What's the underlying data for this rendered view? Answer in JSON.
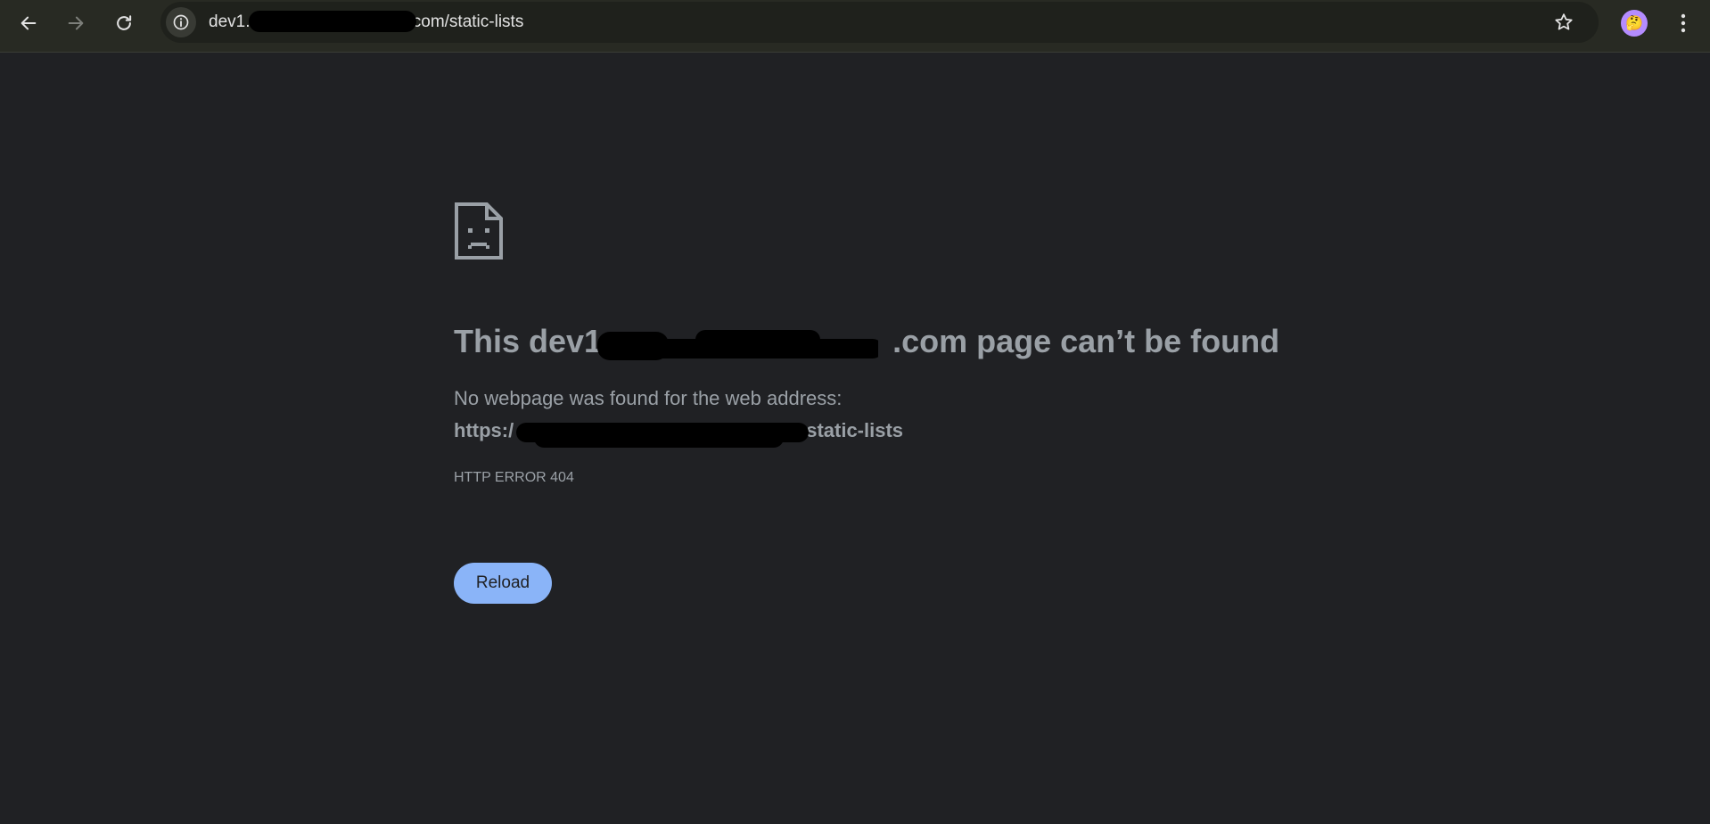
{
  "browser": {
    "url_prefix": "dev1.",
    "url_suffix": ".com/static-lists",
    "profile_emoji": "🤔",
    "icons": {
      "back": "arrow-left-icon",
      "forward": "arrow-right-icon",
      "reload": "reload-icon",
      "site_info": "info-icon",
      "bookmark": "star-icon",
      "menu": "kebab-menu-icon"
    }
  },
  "error_page": {
    "title_prefix": "This dev1.",
    "title_suffix": ".com page can’t be found",
    "description": "No webpage was found for the web address:",
    "url_prefix": "https:/",
    "url_suffix": "static-lists",
    "error_code": "HTTP ERROR 404",
    "reload_label": "Reload",
    "icon": "sad-document-icon"
  },
  "colors": {
    "page_bg": "#202124",
    "toolbar_bg": "#282a23",
    "text_secondary": "#9aa0a6",
    "accent": "#8ab4f8"
  }
}
